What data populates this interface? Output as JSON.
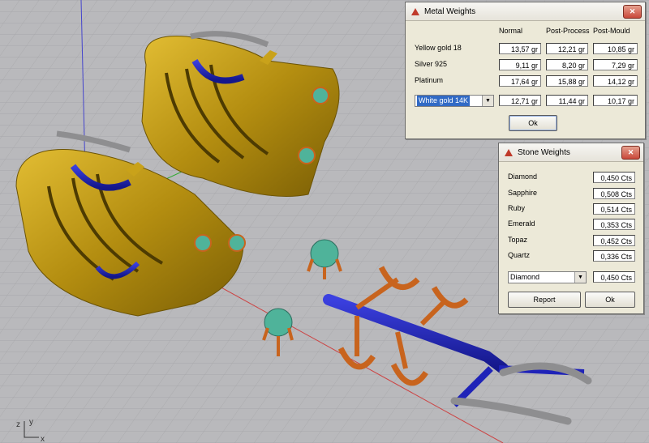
{
  "metal_dialog": {
    "title": "Metal Weights",
    "close_glyph": "✕",
    "columns": [
      "Normal",
      "Post-Process",
      "Post-Mould"
    ],
    "rows": [
      {
        "label": "Yellow gold 18",
        "values": [
          "13,57 gr",
          "12,21 gr",
          "10,85 gr"
        ]
      },
      {
        "label": "Silver 925",
        "values": [
          "9,11 gr",
          "8,20 gr",
          "7,29 gr"
        ]
      },
      {
        "label": "Platinum",
        "values": [
          "17,64 gr",
          "15,88 gr",
          "14,12 gr"
        ]
      }
    ],
    "select": {
      "value": "White gold 14K",
      "arrow": "▼",
      "values": [
        "12,71 gr",
        "11,44 gr",
        "10,17 gr"
      ]
    },
    "ok_label": "Ok"
  },
  "stone_dialog": {
    "title": "Stone Weights",
    "close_glyph": "✕",
    "rows": [
      {
        "label": "Diamond",
        "value": "0,450 Cts"
      },
      {
        "label": "Sapphire",
        "value": "0,508 Cts"
      },
      {
        "label": "Ruby",
        "value": "0,514 Cts"
      },
      {
        "label": "Emerald",
        "value": "0,353 Cts"
      },
      {
        "label": "Topaz",
        "value": "0,452 Cts"
      },
      {
        "label": "Quartz",
        "value": "0,336 Cts"
      }
    ],
    "select": {
      "value": "Diamond",
      "arrow": "▼",
      "result": "0,450 Cts"
    },
    "report_label": "Report",
    "ok_label": "Ok"
  },
  "axis_labels": {
    "y": "y",
    "z": "z",
    "x": "x"
  },
  "colors": {
    "gold": "#c9a21a",
    "gold_dark": "#7a5e05",
    "blue": "#1f23b8",
    "silver": "#8e8e90",
    "copper": "#c8641e",
    "gem": "#4fb39a",
    "grid_bg": "#b9b9bc"
  }
}
